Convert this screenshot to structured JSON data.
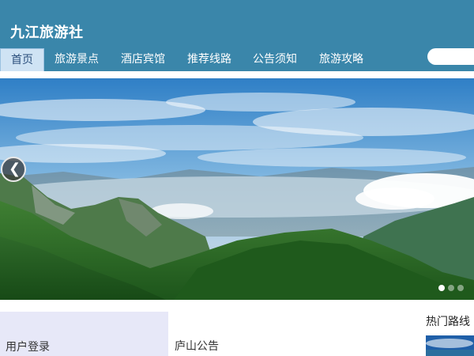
{
  "site": {
    "title": "九江旅游社"
  },
  "nav": {
    "items": [
      {
        "label": "首页",
        "active": true
      },
      {
        "label": "旅游景点",
        "active": false
      },
      {
        "label": "酒店宾馆",
        "active": false
      },
      {
        "label": "推荐线路",
        "active": false
      },
      {
        "label": "公告须知",
        "active": false
      },
      {
        "label": "旅游攻略",
        "active": false
      }
    ]
  },
  "search": {
    "value": "",
    "placeholder": ""
  },
  "banner": {
    "prev_arrow": "❮",
    "slide_count": 3,
    "active_slide": 1
  },
  "sections": {
    "login_title": "用户登录",
    "notice_title": "庐山公告",
    "hot_routes_title": "热门路线"
  },
  "colors": {
    "header_bg": "#3a86aa",
    "nav_active_bg": "#cfe3f4",
    "login_panel_bg": "#e7e8f8"
  }
}
